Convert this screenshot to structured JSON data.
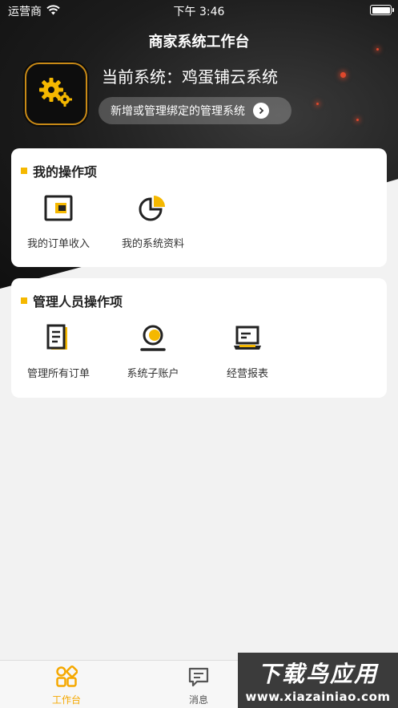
{
  "status_bar": {
    "carrier": "运营商",
    "time": "下午 3:46"
  },
  "header": {
    "title": "商家系统工作台",
    "current_system": "当前系统：鸡蛋铺云系统",
    "manage_button": "新增或管理绑定的管理系统"
  },
  "my_operations": {
    "title": "我的操作项",
    "items": [
      {
        "label": "我的订单收入",
        "icon": "wallet-icon"
      },
      {
        "label": "我的系统资料",
        "icon": "pie-chart-icon"
      }
    ]
  },
  "admin_operations": {
    "title": "管理人员操作项",
    "items": [
      {
        "label": "管理所有订单",
        "icon": "document-list-icon"
      },
      {
        "label": "系统子账户",
        "icon": "user-account-icon"
      },
      {
        "label": "经营报表",
        "icon": "laptop-report-icon"
      }
    ]
  },
  "tabbar": {
    "tabs": [
      {
        "label": "工作台",
        "icon": "grid-icon",
        "active": true
      },
      {
        "label": "消息",
        "icon": "message-icon",
        "active": false
      }
    ]
  },
  "watermark": {
    "top": "下载鸟应用",
    "bottom": "www.xiazainiao.com"
  },
  "colors": {
    "accent": "#f5b800",
    "header_bg": "#1c1c1c",
    "page_bg": "#f2f2f2"
  }
}
